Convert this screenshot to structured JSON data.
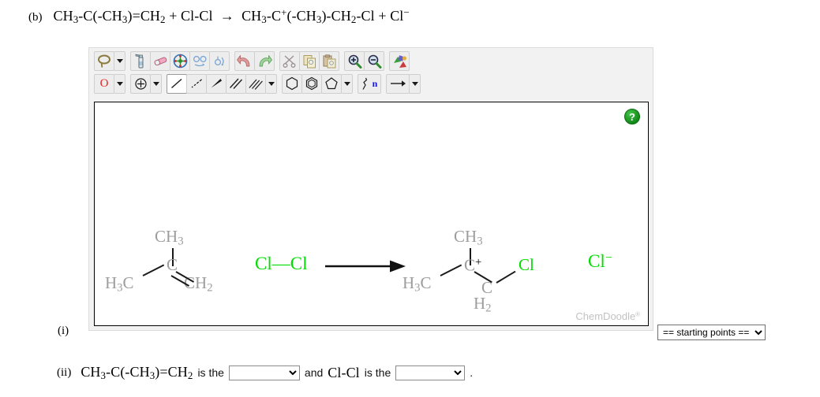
{
  "question": {
    "part_b_label": "(b)",
    "part_b_equation_html": "CH<sub>3</sub>-C(-CH<sub>3</sub>)=CH<sub>2</sub> + Cl-Cl &nbsp;&rarr;&nbsp; CH<sub>3</sub>-C<sup>+</sup>(-CH<sub>3</sub>)-CH<sub>2</sub>-Cl + Cl<sup>&minus;</sup>",
    "part_i_label": "(i)",
    "part_ii_label": "(ii)",
    "part_ii_reactant_1_html": "CH<sub>3</sub>-C(-CH<sub>3</sub>)=CH<sub>2</sub>",
    "part_ii_text_1": "is the",
    "part_ii_conjunction": "and",
    "part_ii_reactant_2_html": "Cl-Cl",
    "part_ii_text_2": "is the",
    "part_ii_period": "."
  },
  "dropdowns": {
    "starting_points": {
      "selected": "== starting points ==",
      "options": [
        "== starting points =="
      ]
    },
    "blank_1": {
      "selected": "",
      "options": [
        ""
      ]
    },
    "blank_2": {
      "selected": "",
      "options": [
        ""
      ]
    }
  },
  "sketcher": {
    "watermark": "ChemDoodle",
    "watermark_mark": "®",
    "help_label": "?",
    "toolbar_row_1": [
      {
        "name": "lasso-select-tool",
        "icon": "lasso-icon",
        "has_caret": true,
        "selected": false
      },
      {
        "name": "clear-tool",
        "icon": "spray-bottle-icon",
        "has_caret": false,
        "selected": false
      },
      {
        "name": "erase-tool",
        "icon": "eraser-icon",
        "has_caret": false,
        "selected": false
      },
      {
        "name": "center-tool",
        "icon": "center-molecule-icon",
        "has_caret": false,
        "selected": false
      },
      {
        "name": "flip-horizontal-tool",
        "icon": "flip-horizontal-icon",
        "has_caret": false,
        "selected": false
      },
      {
        "name": "flip-vertical-tool",
        "icon": "flip-vertical-icon",
        "has_caret": false,
        "selected": false
      },
      {
        "name": "undo-button",
        "icon": "undo-arrow-icon",
        "has_caret": false,
        "selected": false
      },
      {
        "name": "redo-button",
        "icon": "redo-arrow-icon",
        "has_caret": false,
        "selected": false
      },
      {
        "name": "cut-button",
        "icon": "scissors-icon",
        "has_caret": false,
        "selected": false
      },
      {
        "name": "copy-button",
        "icon": "copy-icon",
        "has_caret": false,
        "selected": false
      },
      {
        "name": "paste-button",
        "icon": "paste-icon",
        "has_caret": false,
        "selected": false
      },
      {
        "name": "zoom-in-button",
        "icon": "magnifier-plus-icon",
        "has_caret": false,
        "selected": false
      },
      {
        "name": "zoom-out-button",
        "icon": "magnifier-minus-icon",
        "has_caret": false,
        "selected": false
      },
      {
        "name": "color-tool",
        "icon": "color-palette-icon",
        "has_caret": false,
        "selected": false
      }
    ],
    "toolbar_row_2": [
      {
        "name": "element-tool",
        "icon": "element-letter-icon",
        "label": "O",
        "has_caret": true,
        "selected": false
      },
      {
        "name": "charge-tool",
        "icon": "charge-circle-icon",
        "has_caret": true,
        "selected": false
      },
      {
        "name": "single-bond-tool",
        "icon": "single-bond-icon",
        "has_caret": false,
        "selected": true
      },
      {
        "name": "hash-bond-tool",
        "icon": "hashed-bond-icon",
        "has_caret": false,
        "selected": false
      },
      {
        "name": "wedge-bond-tool",
        "icon": "wedge-bond-icon",
        "has_caret": false,
        "selected": false
      },
      {
        "name": "double-bond-tool",
        "icon": "double-bond-icon",
        "has_caret": false,
        "selected": false
      },
      {
        "name": "triple-bond-tool",
        "icon": "triple-bond-icon",
        "has_caret": true,
        "selected": false
      },
      {
        "name": "benzene-ring-tool",
        "icon": "hexagon-icon",
        "has_caret": false,
        "selected": false
      },
      {
        "name": "aromatic-ring-tool",
        "icon": "aromatic-hexagon-icon",
        "has_caret": false,
        "selected": false
      },
      {
        "name": "cyclopentane-tool",
        "icon": "pentagon-icon",
        "has_caret": true,
        "selected": false
      },
      {
        "name": "chain-tool",
        "icon": "chain-n-icon",
        "label": "n",
        "has_caret": false,
        "selected": false
      },
      {
        "name": "arrow-tool",
        "icon": "right-arrow-icon",
        "has_caret": true,
        "selected": false
      }
    ]
  },
  "structures": {
    "reactant_alkene": {
      "name": "2-methylpropene",
      "atoms": [
        {
          "label_html": "CH<sub>3</sub>",
          "color": "gray"
        },
        {
          "label_html": "C",
          "color": "gray"
        },
        {
          "label_html": "H<sub>3</sub>C",
          "color": "gray"
        },
        {
          "label_html": "CH<sub>2</sub>",
          "color": "gray"
        }
      ]
    },
    "reactant_chlorine": {
      "name": "chlorine-molecule",
      "label_html": "Cl&#8212;Cl",
      "color": "#00dd00"
    },
    "reaction_arrow": {
      "name": "reaction-arrow"
    },
    "product_carbocation": {
      "name": "tert-butyl-carbocation-chloride",
      "atoms": [
        {
          "label_html": "CH<sub>3</sub>",
          "color": "gray"
        },
        {
          "label_html": "C<sup>+</sup>",
          "color": "gray"
        },
        {
          "label_html": "H<sub>3</sub>C",
          "color": "gray"
        },
        {
          "label_html": "C",
          "color": "gray"
        },
        {
          "label_html": "H<sub>2</sub>",
          "color": "gray"
        },
        {
          "label_html": "Cl",
          "color": "#00dd00"
        }
      ]
    },
    "product_chloride_ion": {
      "name": "chloride-ion",
      "label_html": "Cl<sup>&minus;</sup>",
      "color": "#00dd00"
    }
  }
}
